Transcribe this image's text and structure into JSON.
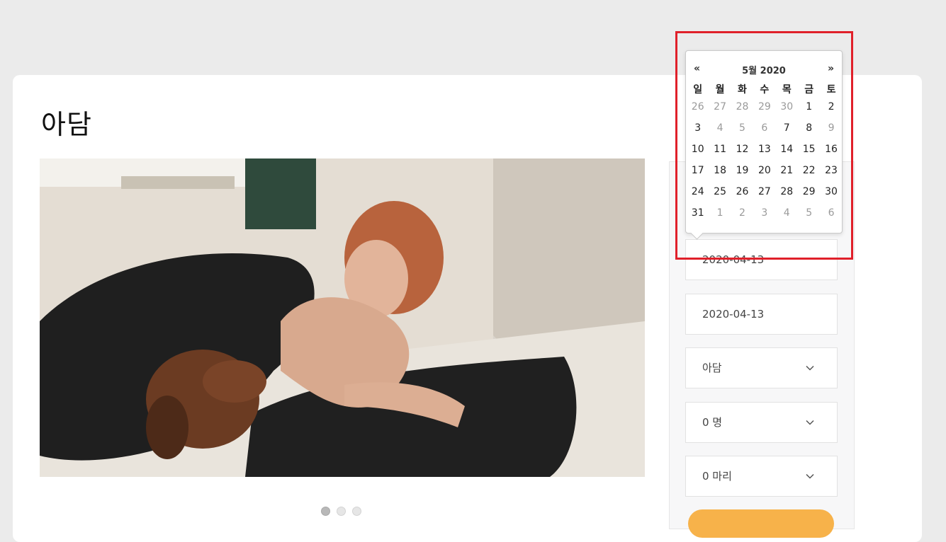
{
  "room": {
    "title": "아담"
  },
  "gallery": {
    "slide_count": 3,
    "active_index": 0
  },
  "booking": {
    "checkin_value": "2020-04-13",
    "checkout_value": "2020-04-13",
    "room_select": "아담",
    "guests_select": "0 명",
    "pets_select": "0 마리"
  },
  "datepicker": {
    "prev": "«",
    "next": "»",
    "title": "5월 2020",
    "weekdays": [
      "일",
      "월",
      "화",
      "수",
      "목",
      "금",
      "토"
    ],
    "weeks": [
      [
        {
          "d": "26",
          "m": true
        },
        {
          "d": "27",
          "m": true
        },
        {
          "d": "28",
          "m": true
        },
        {
          "d": "29",
          "m": true
        },
        {
          "d": "30",
          "m": true
        },
        {
          "d": "1",
          "m": false
        },
        {
          "d": "2",
          "m": false
        }
      ],
      [
        {
          "d": "3",
          "m": false
        },
        {
          "d": "4",
          "m": true
        },
        {
          "d": "5",
          "m": true
        },
        {
          "d": "6",
          "m": true
        },
        {
          "d": "7",
          "m": false
        },
        {
          "d": "8",
          "m": false
        },
        {
          "d": "9",
          "m": true
        }
      ],
      [
        {
          "d": "10",
          "m": false
        },
        {
          "d": "11",
          "m": false
        },
        {
          "d": "12",
          "m": false
        },
        {
          "d": "13",
          "m": false
        },
        {
          "d": "14",
          "m": false
        },
        {
          "d": "15",
          "m": false
        },
        {
          "d": "16",
          "m": false
        }
      ],
      [
        {
          "d": "17",
          "m": false
        },
        {
          "d": "18",
          "m": false
        },
        {
          "d": "19",
          "m": false
        },
        {
          "d": "20",
          "m": false
        },
        {
          "d": "21",
          "m": false
        },
        {
          "d": "22",
          "m": false
        },
        {
          "d": "23",
          "m": false
        }
      ],
      [
        {
          "d": "24",
          "m": false
        },
        {
          "d": "25",
          "m": false
        },
        {
          "d": "26",
          "m": false
        },
        {
          "d": "27",
          "m": false
        },
        {
          "d": "28",
          "m": false
        },
        {
          "d": "29",
          "m": false
        },
        {
          "d": "30",
          "m": false
        }
      ],
      [
        {
          "d": "31",
          "m": false
        },
        {
          "d": "1",
          "m": true
        },
        {
          "d": "2",
          "m": true
        },
        {
          "d": "3",
          "m": true
        },
        {
          "d": "4",
          "m": true
        },
        {
          "d": "5",
          "m": true
        },
        {
          "d": "6",
          "m": true
        }
      ]
    ]
  },
  "colors": {
    "highlight": "#e0202a",
    "button": "#f7b24a"
  },
  "icons": {
    "select": "chevron-down-icon"
  }
}
